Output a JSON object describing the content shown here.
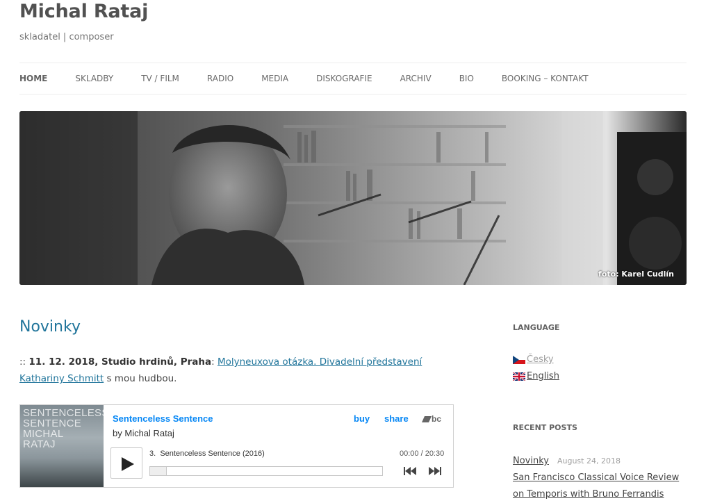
{
  "site": {
    "title": "Michal Rataj",
    "description": "skladatel | composer"
  },
  "nav": {
    "items": [
      {
        "label": "HOME"
      },
      {
        "label": "SKLADBY"
      },
      {
        "label": "TV / FILM"
      },
      {
        "label": "RADIO"
      },
      {
        "label": "MEDIA"
      },
      {
        "label": "DISKOGRAFIE"
      },
      {
        "label": "ARCHIV"
      },
      {
        "label": "BIO"
      },
      {
        "label": "BOOKING – KONTAKT"
      }
    ]
  },
  "header_image": {
    "credit": "foto: Karel Cudlín"
  },
  "post": {
    "title": "Novinky",
    "prefix": "::",
    "event": "11. 12. 2018, Studio hrdinů, Praha",
    "colon": ":",
    "link_text": "Molyneuxova otázka. Divadelní představení Kathariny Schmitt",
    "suffix": "s mou hudbou."
  },
  "bandcamp": {
    "cover_text": [
      "SENTENCELESS",
      "SENTENCE",
      "MICHAL",
      "RATAJ"
    ],
    "album_title": "Sentenceless Sentence",
    "by_label": "by",
    "artist": "Michal Rataj",
    "buy_label": "buy",
    "share_label": "share",
    "logo": "bc",
    "track_number": "3.",
    "track_title": "Sentenceless Sentence (2016)",
    "time": "00:00 / 20:30",
    "progress": 0
  },
  "sidebar": {
    "language_title": "LANGUAGE",
    "languages": [
      {
        "label": "Česky"
      },
      {
        "label": "English"
      }
    ],
    "recent_title": "RECENT POSTS",
    "recent_posts": [
      {
        "title": "Novinky",
        "date": "August 24, 2018"
      },
      {
        "title": "San Francisco Classical Voice Review on Temporis with Bruno Ferrandis (May"
      }
    ]
  },
  "colors": {
    "link": "#21759b",
    "bandcamp_accent": "#0687f5"
  }
}
